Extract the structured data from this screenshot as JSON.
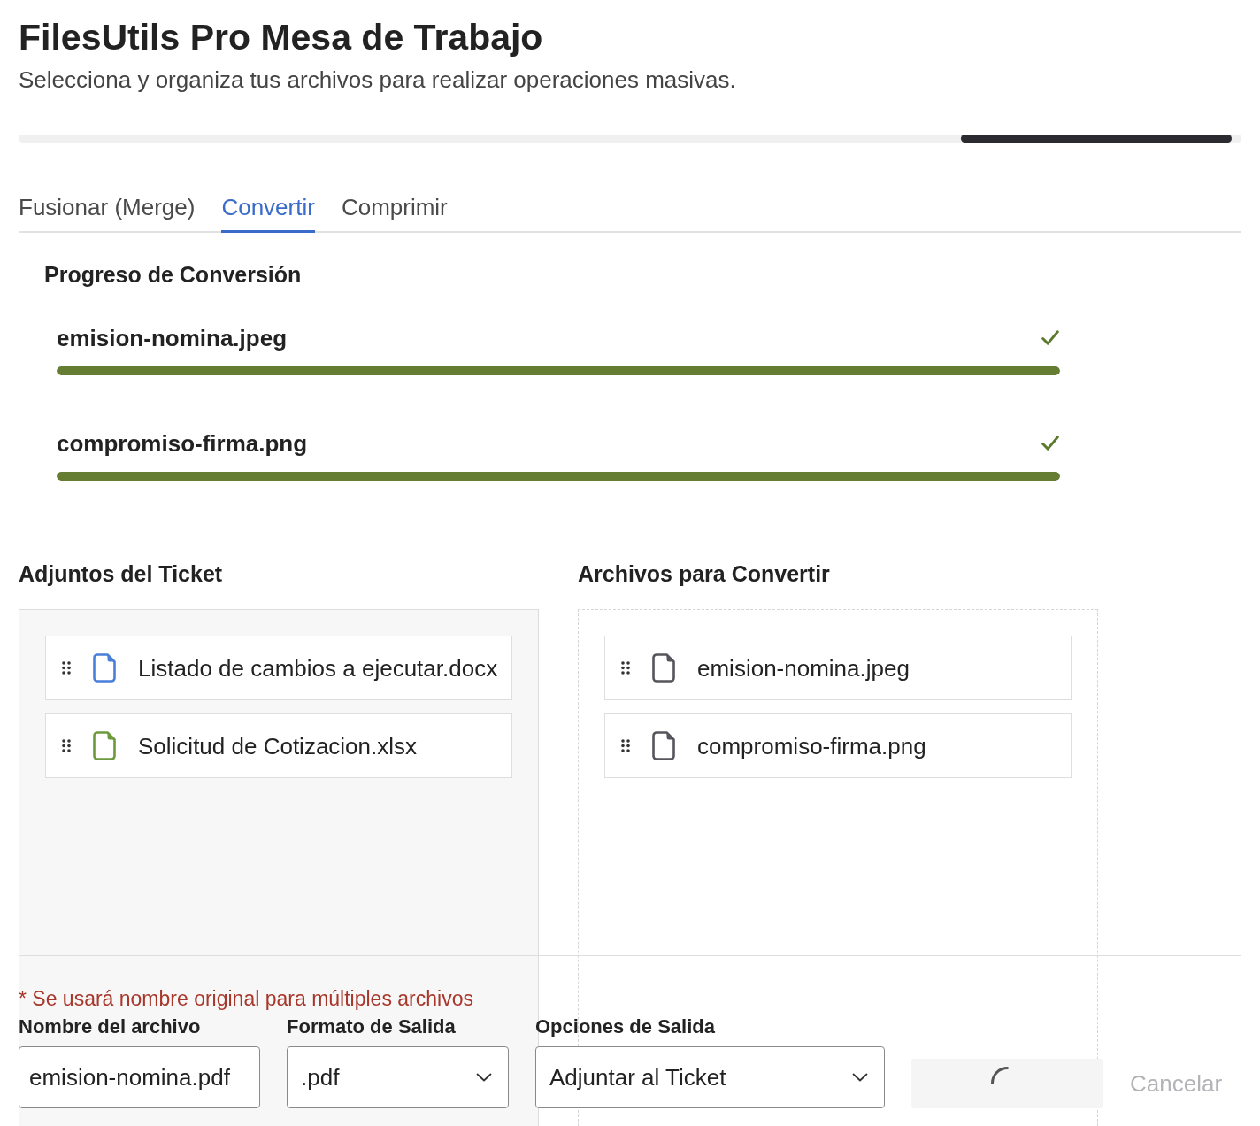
{
  "header": {
    "title": "FilesUtils Pro Mesa de Trabajo",
    "subtitle": "Selecciona y organiza tus archivos para realizar operaciones masivas."
  },
  "tabs": [
    {
      "label": "Fusionar (Merge)",
      "selected": false
    },
    {
      "label": "Convertir",
      "selected": true
    },
    {
      "label": "Comprimir",
      "selected": false
    }
  ],
  "progress": {
    "title": "Progreso de Conversión",
    "items": [
      {
        "name": "emision-nomina.jpeg",
        "level": 1,
        "done": true
      },
      {
        "name": "compromiso-firma.png",
        "level": 1,
        "done": true
      }
    ]
  },
  "ticket_attachments": {
    "title": "Adjuntos del Ticket",
    "files": [
      {
        "name": "Listado de cambios a ejecutar.docx",
        "color": "#4a7fd9"
      },
      {
        "name": "Solicitud de Cotizacion.xlsx",
        "color": "#6b9a3c"
      }
    ]
  },
  "files_to_convert": {
    "title": "Archivos para Convertir",
    "files": [
      {
        "name": "emision-nomina.jpeg",
        "color": "#55555c"
      },
      {
        "name": "compromiso-firma.png",
        "color": "#55555c"
      }
    ]
  },
  "output": {
    "note": "* Se usará nombre original para múltiples archivos",
    "file_name": {
      "label": "Nombre del archivo",
      "value": "emision-nomina.pdf"
    },
    "format": {
      "label": "Formato de Salida",
      "value": ".pdf"
    },
    "destination": {
      "label": "Opciones de Salida",
      "value": "Adjuntar al Ticket"
    },
    "convert_button": {
      "loading": true
    },
    "cancel_button": {
      "label": "Cancelar",
      "disabled": true
    }
  }
}
